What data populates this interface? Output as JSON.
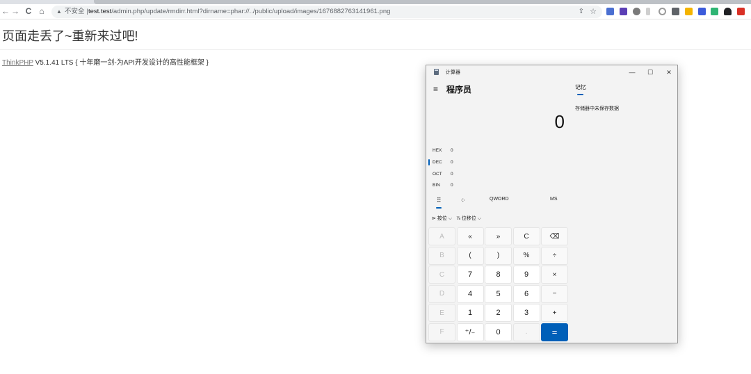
{
  "browser": {
    "back_icon": "←",
    "forward_icon": "→",
    "reload_icon": "C",
    "home_icon": "⌂",
    "warning_icon": "▲",
    "security_label": "不安全 |",
    "url_host": "test.test",
    "url_path": "/admin.php/update/rmdirr.html?dirname=phar://../public/upload/images/1676882763141961.png",
    "share_icon": "⇪",
    "star_icon": "☆"
  },
  "page": {
    "error_title": "页面走丢了~重新来过吧!",
    "footer_link": "ThinkPHP",
    "footer_text": " V5.1.41 LTS { 十年磨一剑-为API开发设计的高性能框架 }"
  },
  "calculator": {
    "window_title": "计算器",
    "minimize_icon": "—",
    "maximize_icon": "☐",
    "close_icon": "✕",
    "menu_icon": "≡",
    "mode_title": "程序员",
    "display_value": "0",
    "bases": [
      {
        "label": "HEX",
        "value": "0"
      },
      {
        "label": "DEC",
        "value": "0"
      },
      {
        "label": "OCT",
        "value": "0"
      },
      {
        "label": "BIN",
        "value": "0"
      }
    ],
    "tabs": {
      "keypad_icon": "⠿",
      "bitflip_icon": "⁘",
      "word_size": "QWORD",
      "memory_store": "MS"
    },
    "ops": {
      "bitwise": "⊳ 按位 ⌵",
      "bitshift": "⅞ 位移位 ⌵"
    },
    "keys": [
      [
        "A",
        "«",
        "»",
        "C",
        "⌫"
      ],
      [
        "B",
        "(",
        ")",
        "%",
        "÷"
      ],
      [
        "C",
        "7",
        "8",
        "9",
        "×"
      ],
      [
        "D",
        "4",
        "5",
        "6",
        "−"
      ],
      [
        "E",
        "1",
        "2",
        "3",
        "+"
      ],
      [
        "F",
        "⁺/₋",
        "0",
        ".",
        "="
      ]
    ],
    "memory_title": "记忆",
    "memory_empty": "存储器中未保存数据",
    "accent_color": "#005fb8"
  }
}
